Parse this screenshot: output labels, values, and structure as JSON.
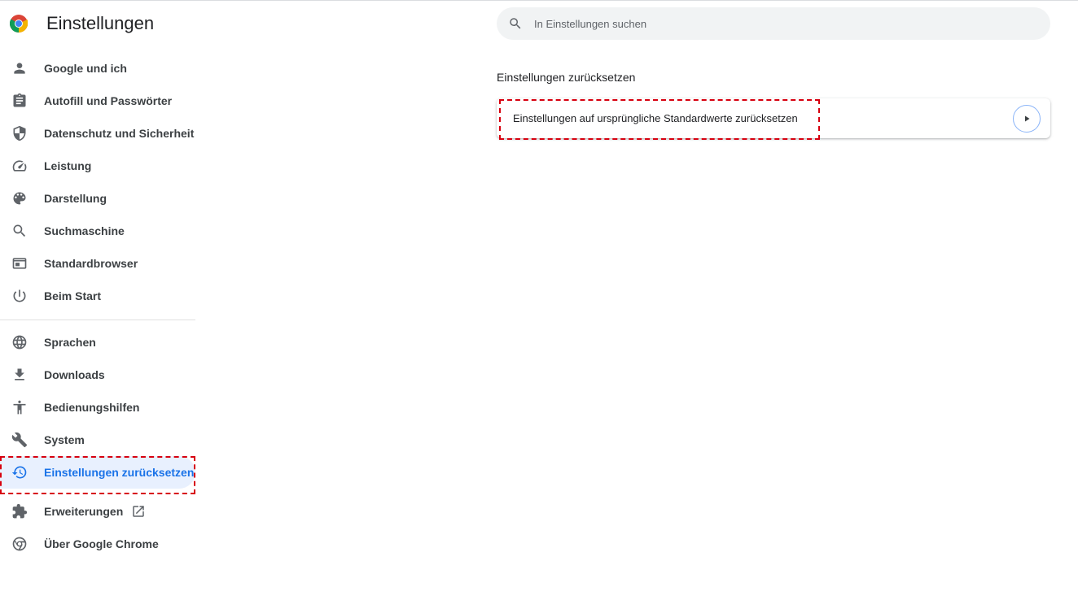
{
  "header": {
    "title": "Einstellungen",
    "logo_icon": "chrome-logo-icon"
  },
  "search": {
    "placeholder": "In Einstellungen suchen",
    "value": ""
  },
  "sidebar": {
    "items": [
      {
        "label": "Google und ich",
        "icon": "person-icon"
      },
      {
        "label": "Autofill und Passwörter",
        "icon": "clipboard-icon"
      },
      {
        "label": "Datenschutz und Sicherheit",
        "icon": "shield-icon"
      },
      {
        "label": "Leistung",
        "icon": "speedometer-icon"
      },
      {
        "label": "Darstellung",
        "icon": "palette-icon"
      },
      {
        "label": "Suchmaschine",
        "icon": "search-icon"
      },
      {
        "label": "Standardbrowser",
        "icon": "browser-window-icon"
      },
      {
        "label": "Beim Start",
        "icon": "power-icon"
      },
      {
        "label": "Sprachen",
        "icon": "globe-icon"
      },
      {
        "label": "Downloads",
        "icon": "download-icon"
      },
      {
        "label": "Bedienungshilfen",
        "icon": "accessibility-icon"
      },
      {
        "label": "System",
        "icon": "wrench-icon"
      },
      {
        "label": "Einstellungen zurücksetzen",
        "icon": "restore-history-icon",
        "active": true
      },
      {
        "label": "Erweiterungen",
        "icon": "puzzle-icon",
        "external": true
      },
      {
        "label": "Über Google Chrome",
        "icon": "chrome-icon"
      }
    ]
  },
  "main": {
    "section_title": "Einstellungen zurücksetzen",
    "card": {
      "label": "Einstellungen auf ursprüngliche Standardwerte zurücksetzen",
      "action_icon": "arrow-right-icon"
    }
  },
  "colors": {
    "accent": "#1a73e8",
    "active_bg": "#e8f0fe",
    "highlight": "#d7000f"
  }
}
